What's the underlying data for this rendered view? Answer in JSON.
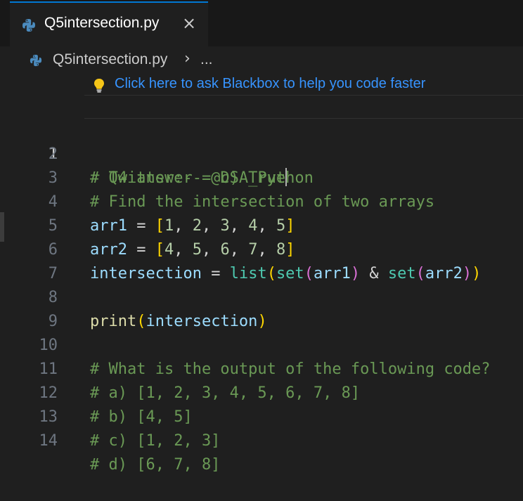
{
  "tab": {
    "label": "Q5intersection.py",
    "close": "×"
  },
  "breadcrumb": {
    "file": "Q5intersection.py",
    "separator": "›",
    "more": "..."
  },
  "hint": {
    "text": "Click here to ask Blackbox to help you code faster"
  },
  "lines": [
    {
      "n": "1",
      "t": "# Q4 answer = c) True"
    },
    {
      "n": "2",
      "t": "# Twitter:-- @DSA_Python"
    },
    {
      "n": "3",
      "t": "# Find the intersection of two arrays"
    },
    {
      "n": "4",
      "t": "arr1 = [1, 2, 3, 4, 5]"
    },
    {
      "n": "5",
      "t": "arr2 = [4, 5, 6, 7, 8]"
    },
    {
      "n": "6",
      "t": "intersection = list(set(arr1) & set(arr2))"
    },
    {
      "n": "7",
      "t": ""
    },
    {
      "n": "8",
      "t": "print(intersection)"
    },
    {
      "n": "9",
      "t": ""
    },
    {
      "n": "10",
      "t": "# What is the output of the following code?"
    },
    {
      "n": "11",
      "t": "# a) [1, 2, 3, 4, 5, 6, 7, 8]"
    },
    {
      "n": "12",
      "t": "# b) [4, 5]"
    },
    {
      "n": "13",
      "t": "# c) [1, 2, 3]"
    },
    {
      "n": "14",
      "t": "# d) [6, 7, 8]"
    }
  ],
  "colors": {
    "background": "#1f1f1f",
    "tab_accent": "#0078d4",
    "comment": "#6a9955",
    "variable": "#9cdcfe",
    "number": "#b5cea8",
    "builtin": "#4ec9b0",
    "function": "#dcdcaa",
    "bracket_1": "#ffd700",
    "bracket_2": "#da70d6",
    "bracket_3": "#179fff",
    "hint": "#3794ff"
  }
}
